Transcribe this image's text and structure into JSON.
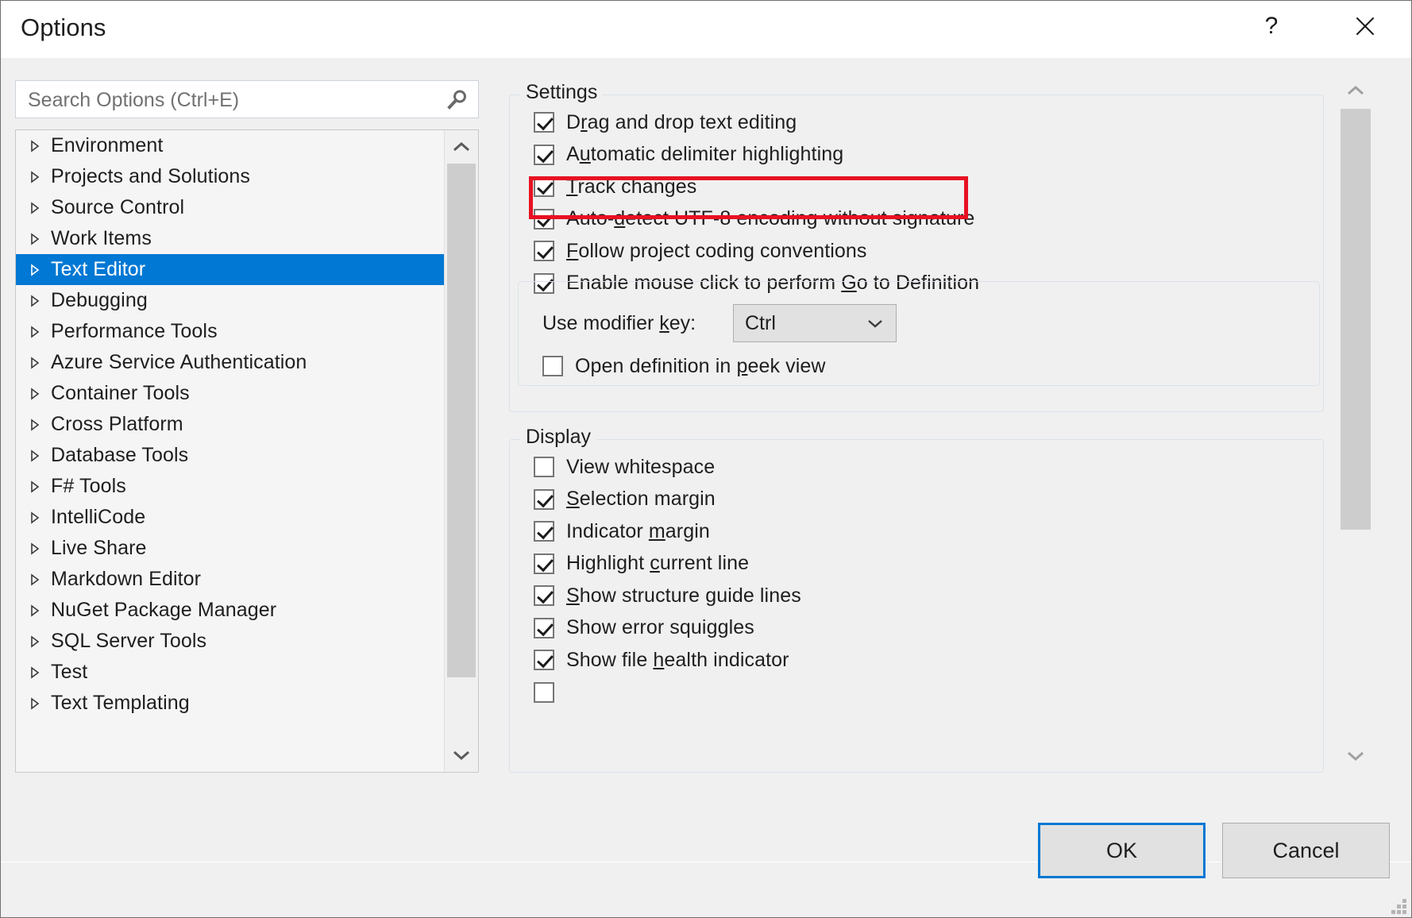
{
  "window": {
    "title": "Options",
    "help_glyph": "?",
    "close_label": "Close"
  },
  "search": {
    "placeholder": "Search Options (Ctrl+E)",
    "value": "",
    "icon": "search-icon"
  },
  "tree": {
    "selected": "Text Editor",
    "items": [
      {
        "label": "Environment"
      },
      {
        "label": "Projects and Solutions"
      },
      {
        "label": "Source Control"
      },
      {
        "label": "Work Items"
      },
      {
        "label": "Text Editor"
      },
      {
        "label": "Debugging"
      },
      {
        "label": "Performance Tools"
      },
      {
        "label": "Azure Service Authentication"
      },
      {
        "label": "Container Tools"
      },
      {
        "label": "Cross Platform"
      },
      {
        "label": "Database Tools"
      },
      {
        "label": "F# Tools"
      },
      {
        "label": "IntelliCode"
      },
      {
        "label": "Live Share"
      },
      {
        "label": "Markdown Editor"
      },
      {
        "label": "NuGet Package Manager"
      },
      {
        "label": "SQL Server Tools"
      },
      {
        "label": "Test"
      },
      {
        "label": "Text Templating"
      }
    ]
  },
  "settings_group": {
    "caption": "Settings",
    "items": [
      {
        "label_pre": "D",
        "acc": "r",
        "label_post": "ag and drop text editing",
        "checked": true
      },
      {
        "label_pre": "A",
        "acc": "u",
        "label_post": "tomatic delimiter highlighting",
        "checked": true
      },
      {
        "label_pre": "",
        "acc": "T",
        "label_post": "rack changes",
        "checked": true
      },
      {
        "label_pre": "Auto-",
        "acc": "d",
        "label_post": "etect UTF-8 encoding without signature",
        "checked": true
      },
      {
        "label_pre": "",
        "acc": "F",
        "label_post": "ollow project coding conventions",
        "checked": true
      },
      {
        "label_pre": "Enable mouse click to perform ",
        "acc": "G",
        "label_post": "o to Definition",
        "checked": true
      }
    ],
    "modifier": {
      "label_pre": "Use modifier ",
      "acc": "k",
      "label_post": "ey:",
      "value": "Ctrl"
    },
    "peek": {
      "label_pre": "Open definition in ",
      "acc": "p",
      "label_post": "eek view",
      "checked": false
    }
  },
  "display_group": {
    "caption": "Display",
    "items": [
      {
        "label_pre": "View whitespace",
        "acc": "",
        "label_post": "",
        "checked": false
      },
      {
        "label_pre": "",
        "acc": "S",
        "label_post": "election margin",
        "checked": true
      },
      {
        "label_pre": "Indicator ",
        "acc": "m",
        "label_post": "argin",
        "checked": true
      },
      {
        "label_pre": "Highlight ",
        "acc": "c",
        "label_post": "urrent line",
        "checked": true
      },
      {
        "label_pre": "",
        "acc": "S",
        "label_post": "how structure guide lines",
        "checked": true
      },
      {
        "label_pre": "Show error squiggles",
        "acc": "",
        "label_post": "",
        "checked": true
      },
      {
        "label_pre": "Show file ",
        "acc": "h",
        "label_post": "ealth indicator",
        "checked": true
      }
    ]
  },
  "annotation": {
    "target": "Automatic delimiter highlighting",
    "color": "#e81123"
  },
  "footer": {
    "ok_label": "OK",
    "cancel_label": "Cancel"
  },
  "colors": {
    "selection": "#0078d4",
    "annotation": "#e81123",
    "dialog_bg": "#f0f0f0"
  }
}
